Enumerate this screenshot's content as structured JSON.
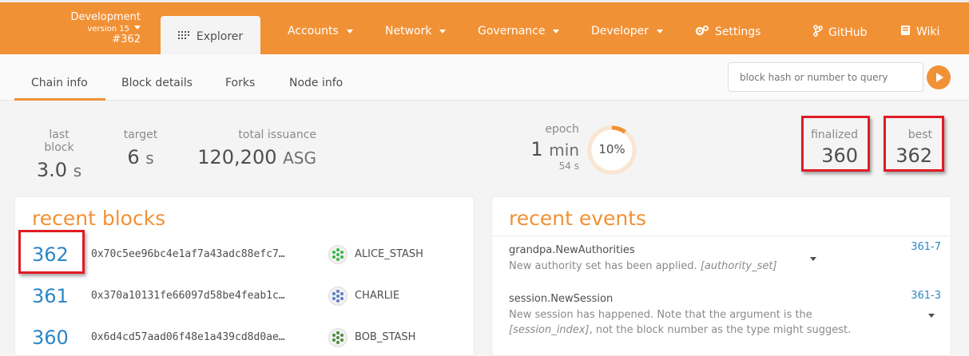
{
  "chain": {
    "name": "Development",
    "version": "version 15",
    "block": "#362"
  },
  "nav": {
    "explorer": "Explorer",
    "accounts": "Accounts",
    "network": "Network",
    "governance": "Governance",
    "developer": "Developer",
    "settings": "Settings",
    "github": "GitHub",
    "wiki": "Wiki"
  },
  "tabs": [
    "Chain info",
    "Block details",
    "Forks",
    "Node info"
  ],
  "search": {
    "placeholder": "block hash or number to query"
  },
  "stats": {
    "last_block": {
      "label": "last block",
      "value": "3.0",
      "unit": "s"
    },
    "target": {
      "label": "target",
      "value": "6",
      "unit": "s"
    },
    "total_issuance": {
      "label": "total issuance",
      "value": "120,200",
      "unit": "ASG"
    },
    "epoch": {
      "label": "epoch",
      "value": "1",
      "unit": "min",
      "sub": "54 s",
      "progress": "10%",
      "progress_fraction": 0.1
    },
    "finalized": {
      "label": "finalized",
      "value": "360"
    },
    "best": {
      "label": "best",
      "value": "362"
    }
  },
  "recent_blocks": {
    "title": "recent blocks",
    "rows": [
      {
        "number": "362",
        "hash": "0x70c5ee96bc4e1af7a43adc88efc7…",
        "author": "ALICE_STASH"
      },
      {
        "number": "361",
        "hash": "0x370a10131fe66097d58be4feab1c…",
        "author": "CHARLIE"
      },
      {
        "number": "360",
        "hash": "0x6d4cd57aad06f48e1a439cd8d0ae…",
        "author": "BOB_STASH"
      }
    ]
  },
  "recent_events": {
    "title": "recent events",
    "items": [
      {
        "name": "grandpa.NewAuthorities",
        "desc": "New authority set has been applied.",
        "arg": "[authority_set]",
        "id": "361-7"
      },
      {
        "name": "session.NewSession",
        "desc": "New session has happened. Note that the argument is the",
        "arg": "[session_index]",
        "desc2": ", not the block number as the type might suggest.",
        "id": "361-3"
      }
    ]
  },
  "colors": {
    "accent": "#f19135",
    "link": "#2d86c5",
    "highlight": "#e01b24"
  }
}
